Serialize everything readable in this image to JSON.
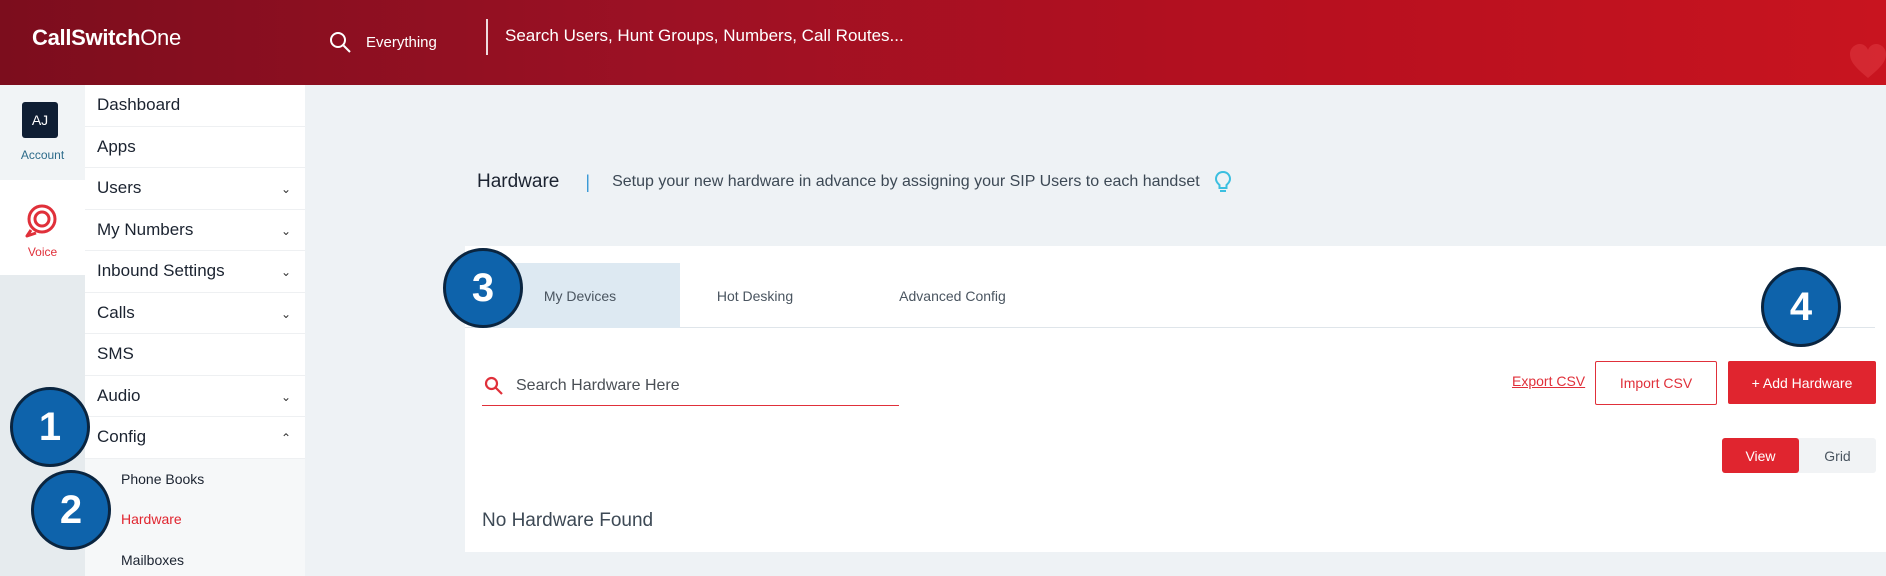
{
  "header": {
    "logo_bold": "CallSwitch",
    "logo_light": "One",
    "scope_label": "Everything",
    "global_search": "Search Users, Hunt Groups, Numbers, Call Routes..."
  },
  "rail": {
    "account_initials": "AJ",
    "account_label": "Account",
    "voice_label": "Voice"
  },
  "sidebar": {
    "items": [
      {
        "label": "Dashboard",
        "chevron": ""
      },
      {
        "label": "Apps",
        "chevron": ""
      },
      {
        "label": "Users",
        "chevron": "⌄"
      },
      {
        "label": "My Numbers",
        "chevron": "⌄"
      },
      {
        "label": "Inbound Settings",
        "chevron": "⌄"
      },
      {
        "label": "Calls",
        "chevron": "⌄"
      },
      {
        "label": "SMS",
        "chevron": ""
      },
      {
        "label": "Audio",
        "chevron": "⌄"
      },
      {
        "label": "Config",
        "chevron": "⌃"
      }
    ],
    "subitems": [
      "Phone Books",
      "Hardware",
      "Mailboxes"
    ]
  },
  "page": {
    "title": "Hardware",
    "separator": "|",
    "description": "Setup your new hardware in advance by assigning your SIP Users to each handset"
  },
  "tabs": [
    "My Devices",
    "Hot Desking",
    "Advanced Config"
  ],
  "toolbar": {
    "search_placeholder": "Search Hardware Here",
    "export_label": "Export CSV",
    "import_label": "Import CSV",
    "add_label": "+ Add Hardware"
  },
  "view_toggle": {
    "view": "View",
    "grid": "Grid"
  },
  "empty_message": "No Hardware Found",
  "callouts": [
    "1",
    "2",
    "3",
    "4"
  ],
  "colors": {
    "brand_red": "#e0252f",
    "header_dark": "#7c0d1d",
    "callout_blue": "#0e63ab"
  }
}
